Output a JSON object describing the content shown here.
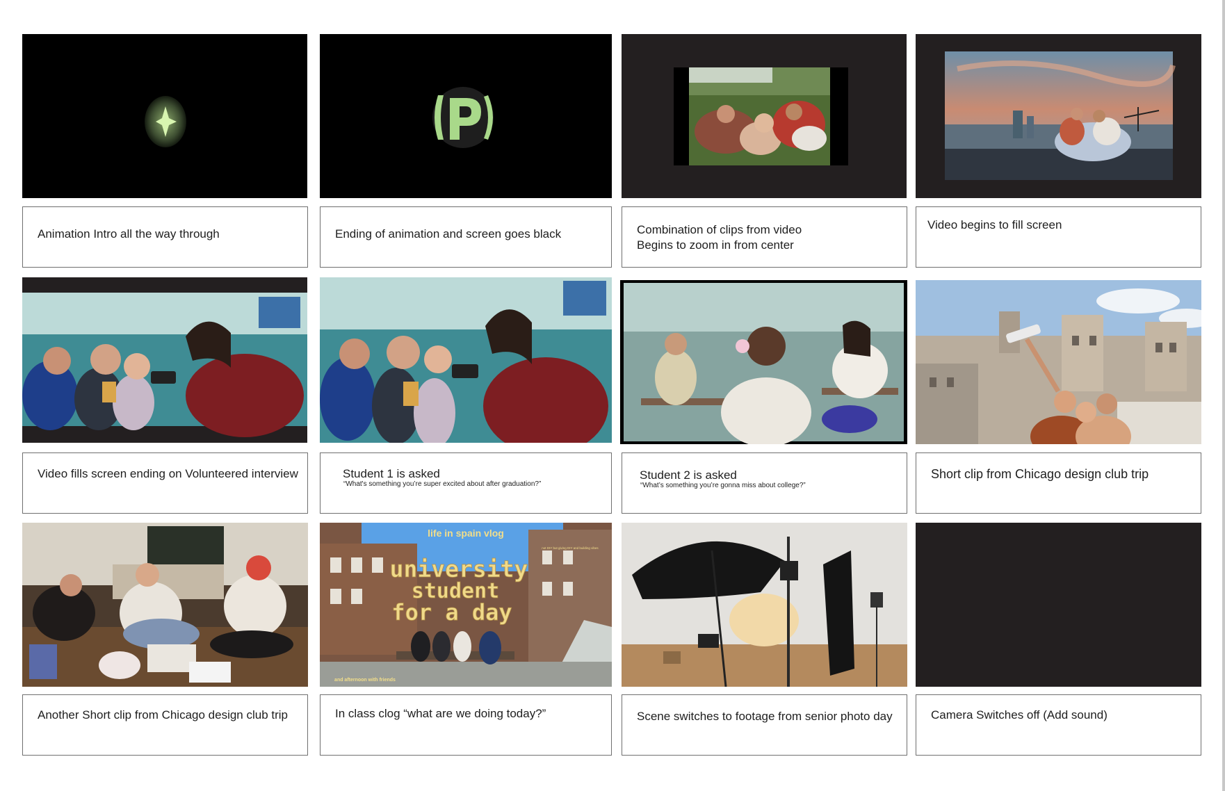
{
  "colors": {
    "frame_black": "#000000",
    "frame_dark": "#231f20",
    "border": "#6f6f6f",
    "glow_green": "#b7e48c"
  },
  "frames": [
    {
      "content": "star-glow-icon"
    },
    {
      "content": "p-logo-glow-icon"
    },
    {
      "content": "friends-on-grass-clip"
    },
    {
      "content": "rooftop-friends-clip"
    },
    {
      "content": "friends-with-phone-clip"
    },
    {
      "content": "friends-with-phone-full-clip"
    },
    {
      "content": "student-in-classroom-clip"
    },
    {
      "content": "selfie-in-chicago-clip"
    },
    {
      "content": "friends-crafting-clip"
    },
    {
      "content": "spain-vlog-thumbnail",
      "thumb": {
        "top_text": "life in spain vlog",
        "big_line1": "university",
        "big_line2": "student",
        "big_line3": "for a day",
        "bottom_text": "and afternoon with friends",
        "corner_note": "not DIY but giving DIY and building vibes"
      }
    },
    {
      "content": "photo-studio-clip"
    },
    {
      "content": "blank-dark-frame"
    }
  ],
  "captions": [
    {
      "text": "Animation Intro all the way through"
    },
    {
      "text": "Ending of animation and screen goes black"
    },
    {
      "line1": "Combination of clips from video",
      "line2": "Begins to zoom in from center"
    },
    {
      "text": "Video begins to fill screen"
    },
    {
      "text": "Video fills screen ending on Volunteered interview"
    },
    {
      "line1": "Student 1 is asked",
      "quote": "“What's something you’re super excited about after graduation?”"
    },
    {
      "line1": "Student 2 is asked",
      "quote": "“What’s something you’re gonna miss about college?”"
    },
    {
      "text": "Short clip from Chicago design club trip"
    },
    {
      "text": "Another Short clip from Chicago design club trip"
    },
    {
      "text": "In class clog “what are we doing today?”"
    },
    {
      "text": "Scene switches to footage from senior photo day"
    },
    {
      "text": "Camera Switches off (Add sound)"
    }
  ]
}
